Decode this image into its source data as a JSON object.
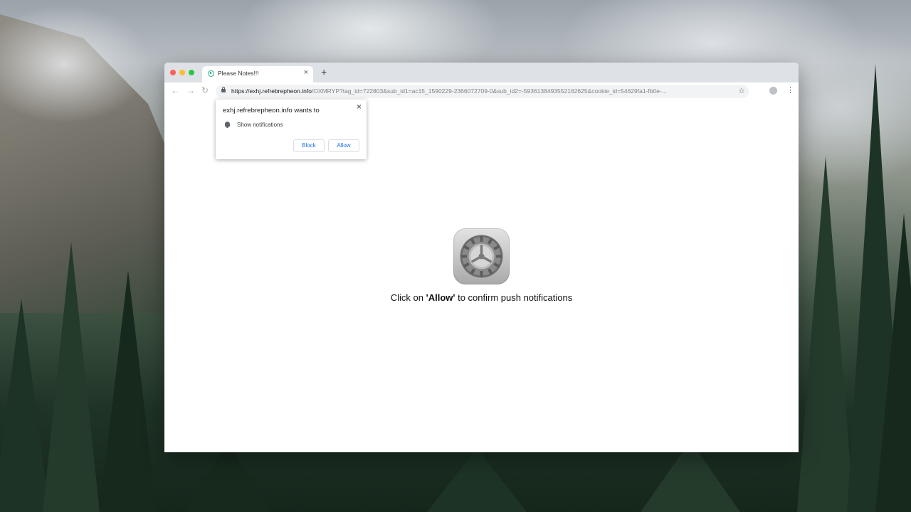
{
  "browser": {
    "tab": {
      "title": "Please Notes!!!",
      "close": "×",
      "new_tab": "+"
    },
    "toolbar": {
      "back": "←",
      "forward": "→",
      "reload": "↻",
      "url_domain": "https://exhj.refrebrepheon.info",
      "url_rest": "/OXMRYP?tag_id=722803&sub_id1=ac15_1590229-2366072709-0&sub_id2=-5936138493552162625&cookie_id=54629fa1-fb0e-...",
      "star": "☆",
      "menu": "⋮"
    }
  },
  "permission_popup": {
    "title": "exhj.refrebrepheon.info wants to",
    "permission": "Show notifications",
    "close": "×",
    "block_label": "Block",
    "allow_label": "Allow"
  },
  "page": {
    "cta_prefix": "Click on ",
    "cta_bold": "'Allow'",
    "cta_suffix": " to confirm push notifications"
  },
  "colors": {
    "link_blue": "#1a73e8",
    "favicon_green": "#2ab38b"
  },
  "icons": [
    "lock-icon",
    "bell-icon",
    "star-icon",
    "profile-icon",
    "menu-icon",
    "settings-gear-icon"
  ]
}
